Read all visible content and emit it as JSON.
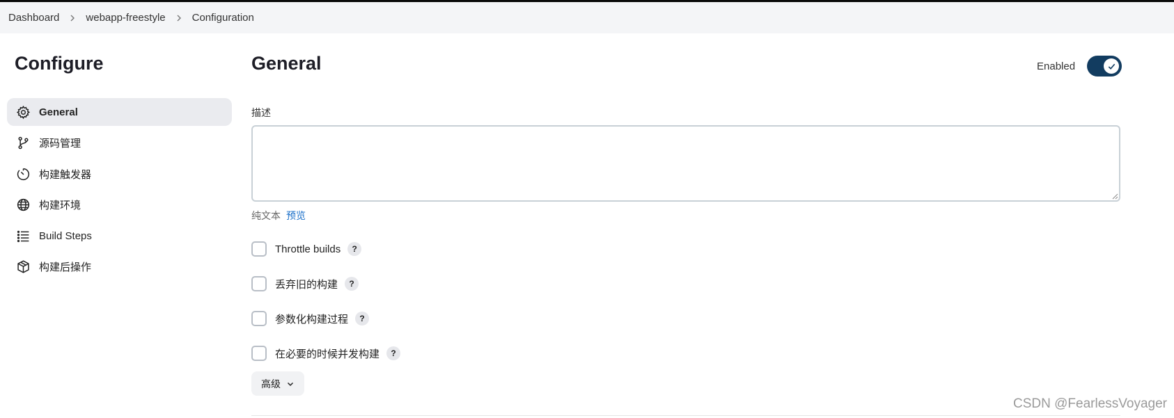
{
  "breadcrumb": {
    "items": [
      "Dashboard",
      "webapp-freestyle",
      "Configuration"
    ]
  },
  "sidebar": {
    "title": "Configure",
    "items": [
      {
        "label": "General",
        "icon": "gear-icon",
        "active": true
      },
      {
        "label": "源码管理",
        "icon": "git-branch-icon",
        "active": false
      },
      {
        "label": "构建触发器",
        "icon": "timer-icon",
        "active": false
      },
      {
        "label": "构建环境",
        "icon": "globe-icon",
        "active": false
      },
      {
        "label": "Build Steps",
        "icon": "list-icon",
        "active": false
      },
      {
        "label": "构建后操作",
        "icon": "package-icon",
        "active": false
      }
    ]
  },
  "main": {
    "title": "General",
    "enabled_label": "Enabled",
    "enabled": true,
    "description_label": "描述",
    "description_value": "",
    "format": {
      "plain": "纯文本",
      "preview": "预览"
    },
    "options": [
      {
        "label": "Throttle builds",
        "checked": false
      },
      {
        "label": "丢弃旧的构建",
        "checked": false
      },
      {
        "label": "参数化构建过程",
        "checked": false
      },
      {
        "label": "在必要的时候并发构建",
        "checked": false
      }
    ],
    "help_glyph": "?",
    "advanced_label": "高级"
  },
  "watermark": "CSDN @FearlessVoyager",
  "colors": {
    "toggle_on": "#123c60",
    "link": "#1a6fc9",
    "active_nav_bg": "#eaebef"
  }
}
